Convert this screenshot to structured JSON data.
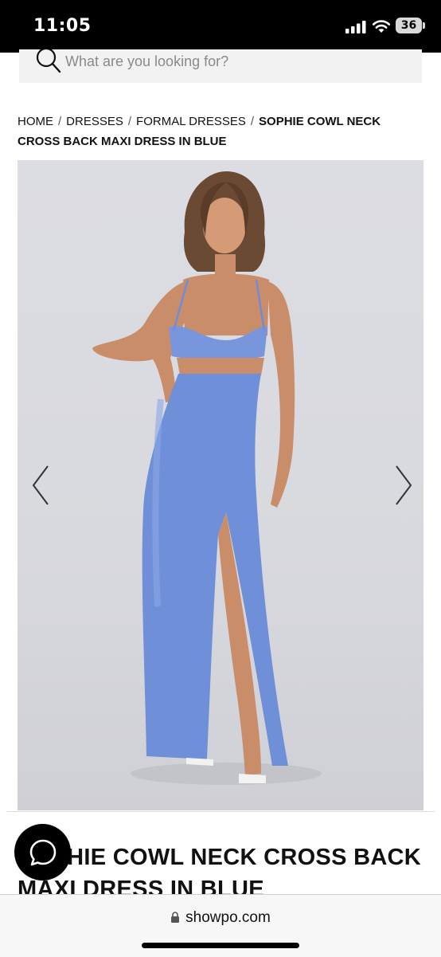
{
  "status_bar": {
    "time": "11:05",
    "battery": "36",
    "icons": [
      "signal-icon",
      "wifi-icon",
      "battery-icon"
    ]
  },
  "search": {
    "placeholder": "What are you looking for?",
    "icon": "search-icon"
  },
  "breadcrumb": {
    "items": [
      "HOME",
      "DRESSES",
      "FORMAL DRESSES"
    ],
    "separator": "/",
    "current": "SOPHIE COWL NECK CROSS BACK MAXI DRESS IN BLUE"
  },
  "gallery": {
    "prev_icon": "chevron-left-icon",
    "next_icon": "chevron-right-icon",
    "dress_color": "#6f8fd8",
    "background_color": "#d9dade"
  },
  "product": {
    "title": "SOPHIE COWL NECK CROSS BACK MAXI DRESS IN BLUE"
  },
  "chat": {
    "icon": "chat-bubble-icon"
  },
  "browser": {
    "url": "showpo.com",
    "icon": "lock-icon"
  }
}
